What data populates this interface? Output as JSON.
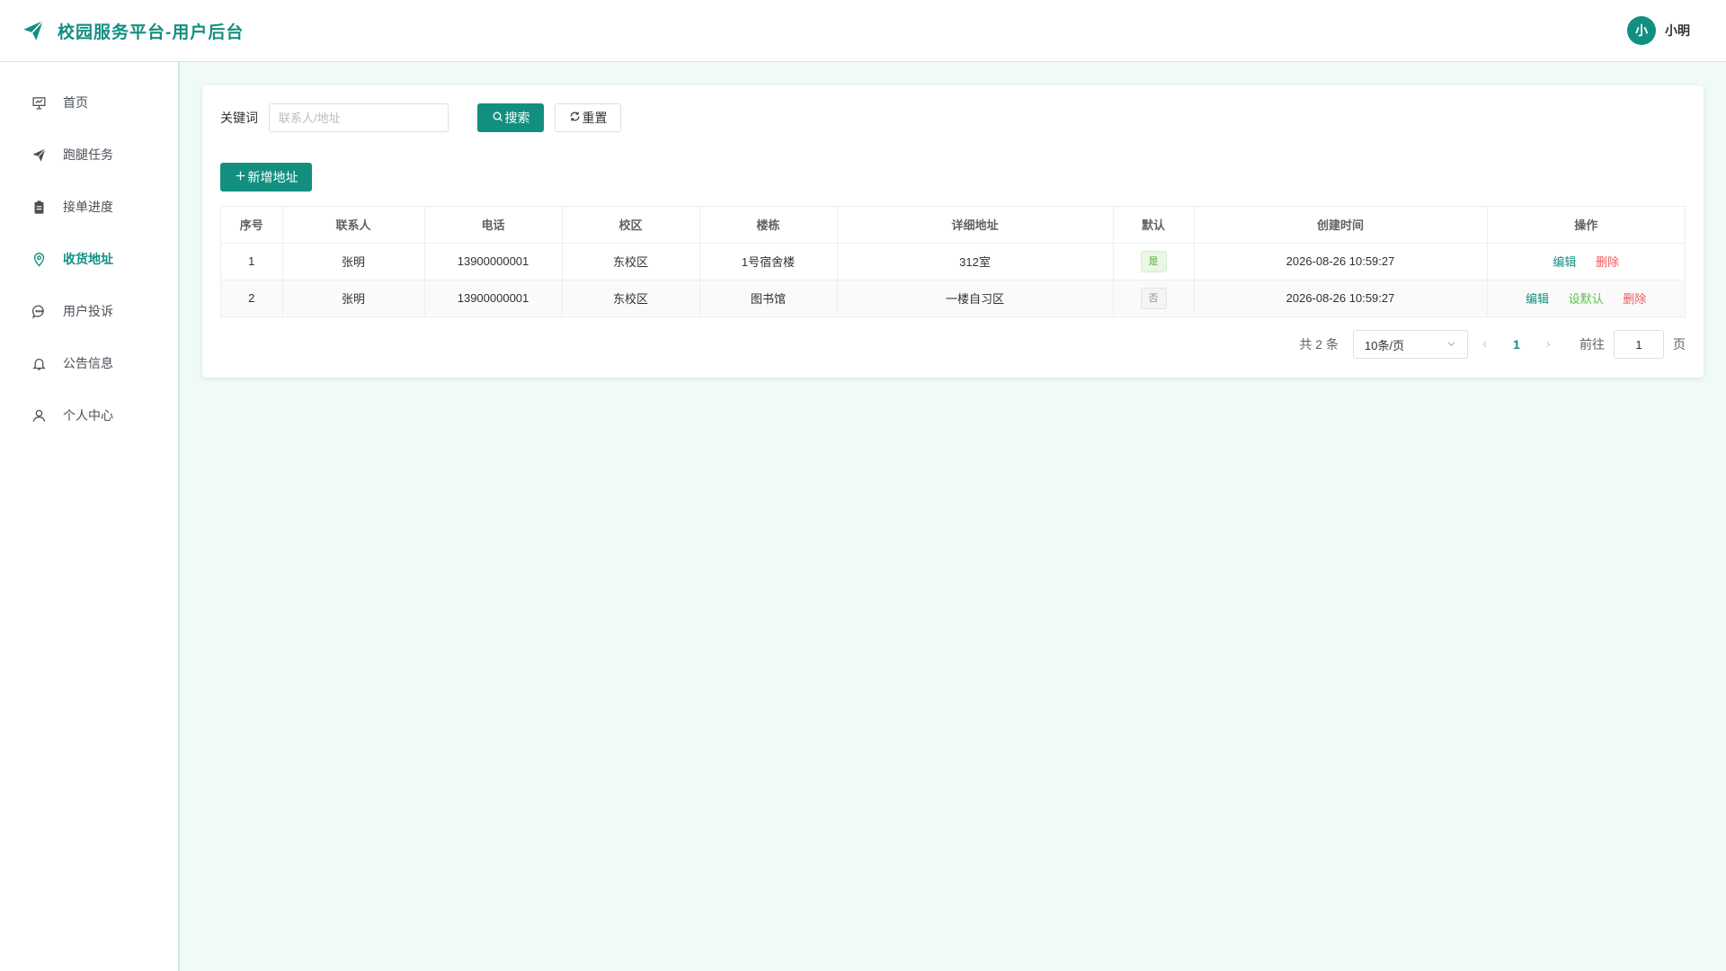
{
  "header": {
    "title": "校园服务平台-用户后台",
    "user_avatar_text": "小",
    "user_name": "小明"
  },
  "colors": {
    "accent": "#138f80",
    "background": "#f0fbf8",
    "success": "#58c14a",
    "danger": "#f25656"
  },
  "sidebar": {
    "items": [
      {
        "label": "首页",
        "icon": "presentation-board-icon",
        "active": false
      },
      {
        "label": "跑腿任务",
        "icon": "paper-plane-icon",
        "active": false
      },
      {
        "label": "接单进度",
        "icon": "clipboard-icon",
        "active": false
      },
      {
        "label": "收货地址",
        "icon": "location-pin-icon",
        "active": true
      },
      {
        "label": "用户投诉",
        "icon": "chat-bubble-icon",
        "active": false
      },
      {
        "label": "公告信息",
        "icon": "bell-icon",
        "active": false
      },
      {
        "label": "个人中心",
        "icon": "user-icon",
        "active": false
      }
    ]
  },
  "search": {
    "keyword_label": "关键词",
    "keyword_placeholder": "联系人/地址",
    "keyword_value": "",
    "search_label": "搜索",
    "reset_label": "重置"
  },
  "toolbar": {
    "add_label": "新增地址"
  },
  "table": {
    "columns": [
      "序号",
      "联系人",
      "电话",
      "校区",
      "楼栋",
      "详细地址",
      "默认",
      "创建时间",
      "操作"
    ],
    "rows": [
      {
        "index": "1",
        "contact": "张明",
        "phone": "13900000001",
        "campus": "东校区",
        "building": "1号宿舍楼",
        "detail": "312室",
        "is_default": true,
        "default_text": "是",
        "created": "2026-08-26 10:59:27",
        "actions": [
          {
            "label": "编辑",
            "type": "edit"
          },
          {
            "label": "删除",
            "type": "delete"
          }
        ]
      },
      {
        "index": "2",
        "contact": "张明",
        "phone": "13900000001",
        "campus": "东校区",
        "building": "图书馆",
        "detail": "一楼自习区",
        "is_default": false,
        "default_text": "否",
        "created": "2026-08-26 10:59:27",
        "actions": [
          {
            "label": "编辑",
            "type": "edit"
          },
          {
            "label": "设默认",
            "type": "default"
          },
          {
            "label": "删除",
            "type": "delete"
          }
        ]
      }
    ]
  },
  "pagination": {
    "total_text": "共 2 条",
    "page_size_text": "10条/页",
    "current_page": "1",
    "goto_label": "前往",
    "goto_value": "1",
    "page_suffix": "页"
  }
}
